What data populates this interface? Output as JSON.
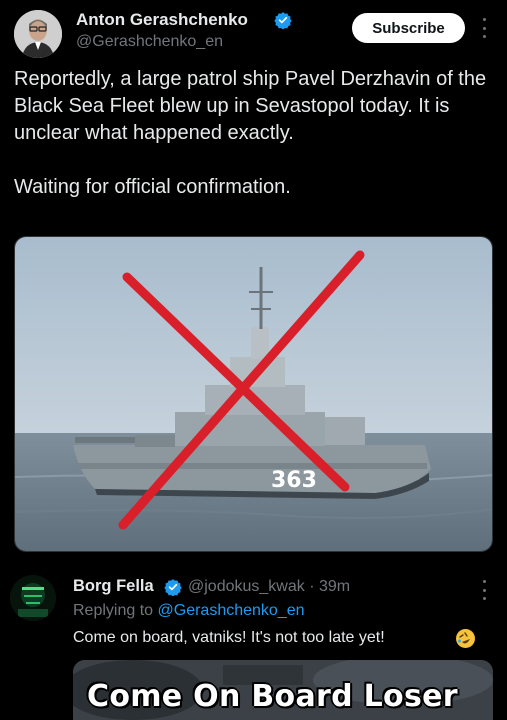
{
  "post": {
    "author": {
      "name": "Anton Gerashchenko",
      "handle": "@Gerashchenko_en",
      "verified": true
    },
    "subscribe_label": "Subscribe",
    "text_paragraphs": [
      "Reportedly, a large patrol ship Pavel Derzhavin of the Black Sea Fleet blew up in Sevastopol today. It is unclear what happened exactly.",
      "Waiting for official confirmation."
    ],
    "image": {
      "hull_number": "363"
    }
  },
  "reply": {
    "author": {
      "name": "Borg Fella",
      "handle": "@jodokus_kwak",
      "verified": true
    },
    "time": "· 39m",
    "replying_prefix": "Replying to",
    "replying_to": "@Gerashchenko_en",
    "text": "Come on board, vatniks! It's not too late yet!",
    "emoji": "rolling-on-floor-laughing-emoji",
    "media_text": "Come On Board Loser"
  },
  "colors": {
    "background": "#000000",
    "text": "#e7e9ea",
    "secondary_text": "#71767b",
    "link": "#1d9bf0",
    "verified_badge": "#1d9bf0",
    "x_mark": "#d81f2a"
  }
}
